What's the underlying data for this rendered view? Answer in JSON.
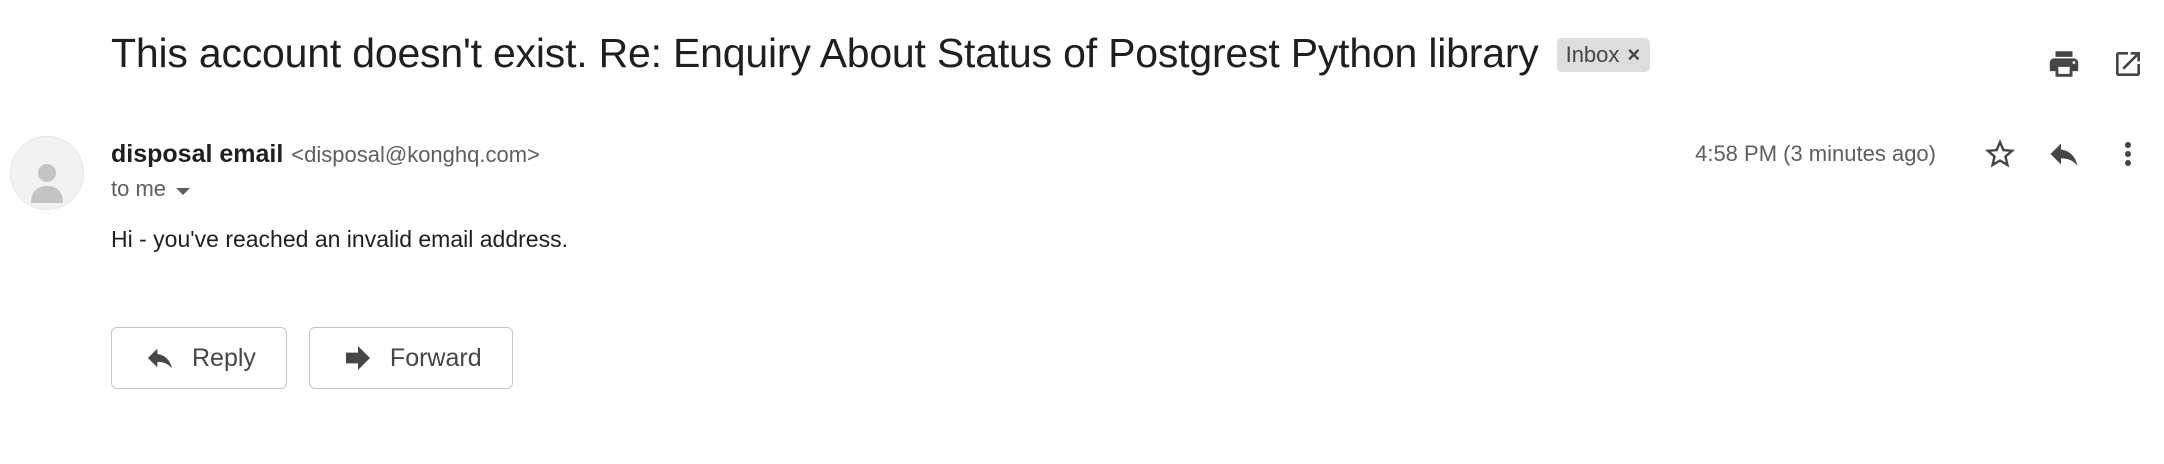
{
  "email": {
    "subject": "This account doesn't exist. Re: Enquiry About Status of Postgrest Python library",
    "label": "Inbox",
    "sender_name": "disposal email",
    "sender_email": "<disposal@konghq.com>",
    "recipient": "to me",
    "timestamp": "4:58 PM (3 minutes ago)",
    "body": "Hi - you've reached an invalid email address."
  },
  "actions": {
    "reply_label": "Reply",
    "forward_label": "Forward"
  },
  "icons": {
    "print": "print-icon",
    "open_new_window": "open-in-new-window-icon",
    "star": "star-icon",
    "reply": "reply-icon",
    "more": "more-vert-icon",
    "forward": "forward-icon",
    "avatar": "person-icon"
  },
  "colors": {
    "text_primary": "#1f1f1f",
    "text_secondary": "#5e5e5e",
    "chip_background": "#dddddd",
    "button_border": "#c4c7c5",
    "icon": "#444746"
  }
}
